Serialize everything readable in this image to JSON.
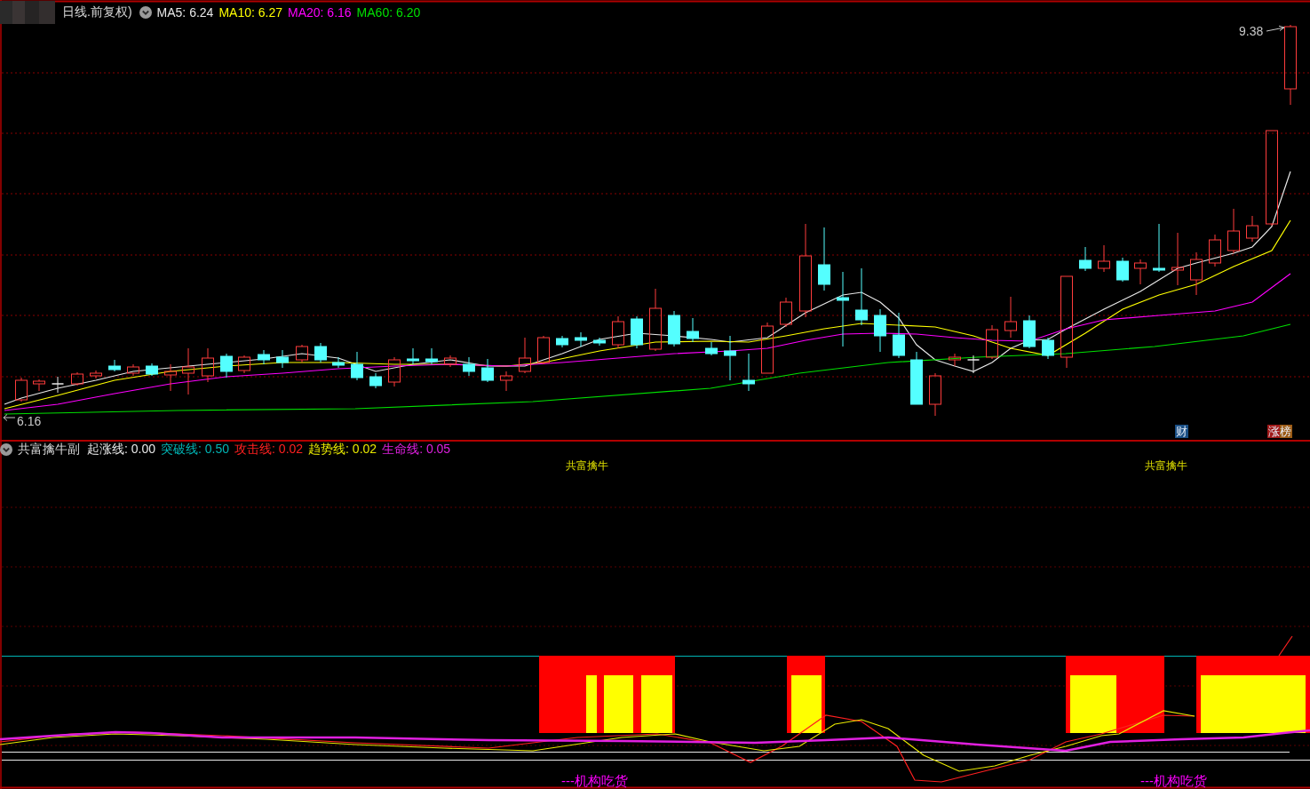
{
  "main_chart": {
    "title": "日线.前复权)",
    "indicators": [
      {
        "label": "MA5: 6.24",
        "color": "#e8e8e8"
      },
      {
        "label": "MA10: 6.27",
        "color": "#ffff00"
      },
      {
        "label": "MA20: 6.16",
        "color": "#ff00ff"
      },
      {
        "label": "MA60: 6.20",
        "color": "#00e000"
      }
    ],
    "high_price": "9.38",
    "low_price": "6.16",
    "badges": [
      {
        "kind": "finance",
        "text": "财"
      },
      {
        "kind": "limit_up",
        "text": "涨榜"
      }
    ]
  },
  "sub_chart": {
    "title": "共富擒牛副",
    "indicators": [
      {
        "label": "起涨线: 0.00",
        "color": "#e8e8e8"
      },
      {
        "label": "突破线: 0.50",
        "color": "#00b4b4"
      },
      {
        "label": "攻击线: 0.02",
        "color": "#ff2020"
      },
      {
        "label": "趋势线: 0.02",
        "color": "#e8e800"
      },
      {
        "label": "生命线: 0.05",
        "color": "#e020e0"
      }
    ],
    "top_signals": [
      "共富擒牛",
      "共富擒牛"
    ],
    "bottom_signals": [
      "---机构吃货",
      "---机构吃货"
    ]
  }
}
